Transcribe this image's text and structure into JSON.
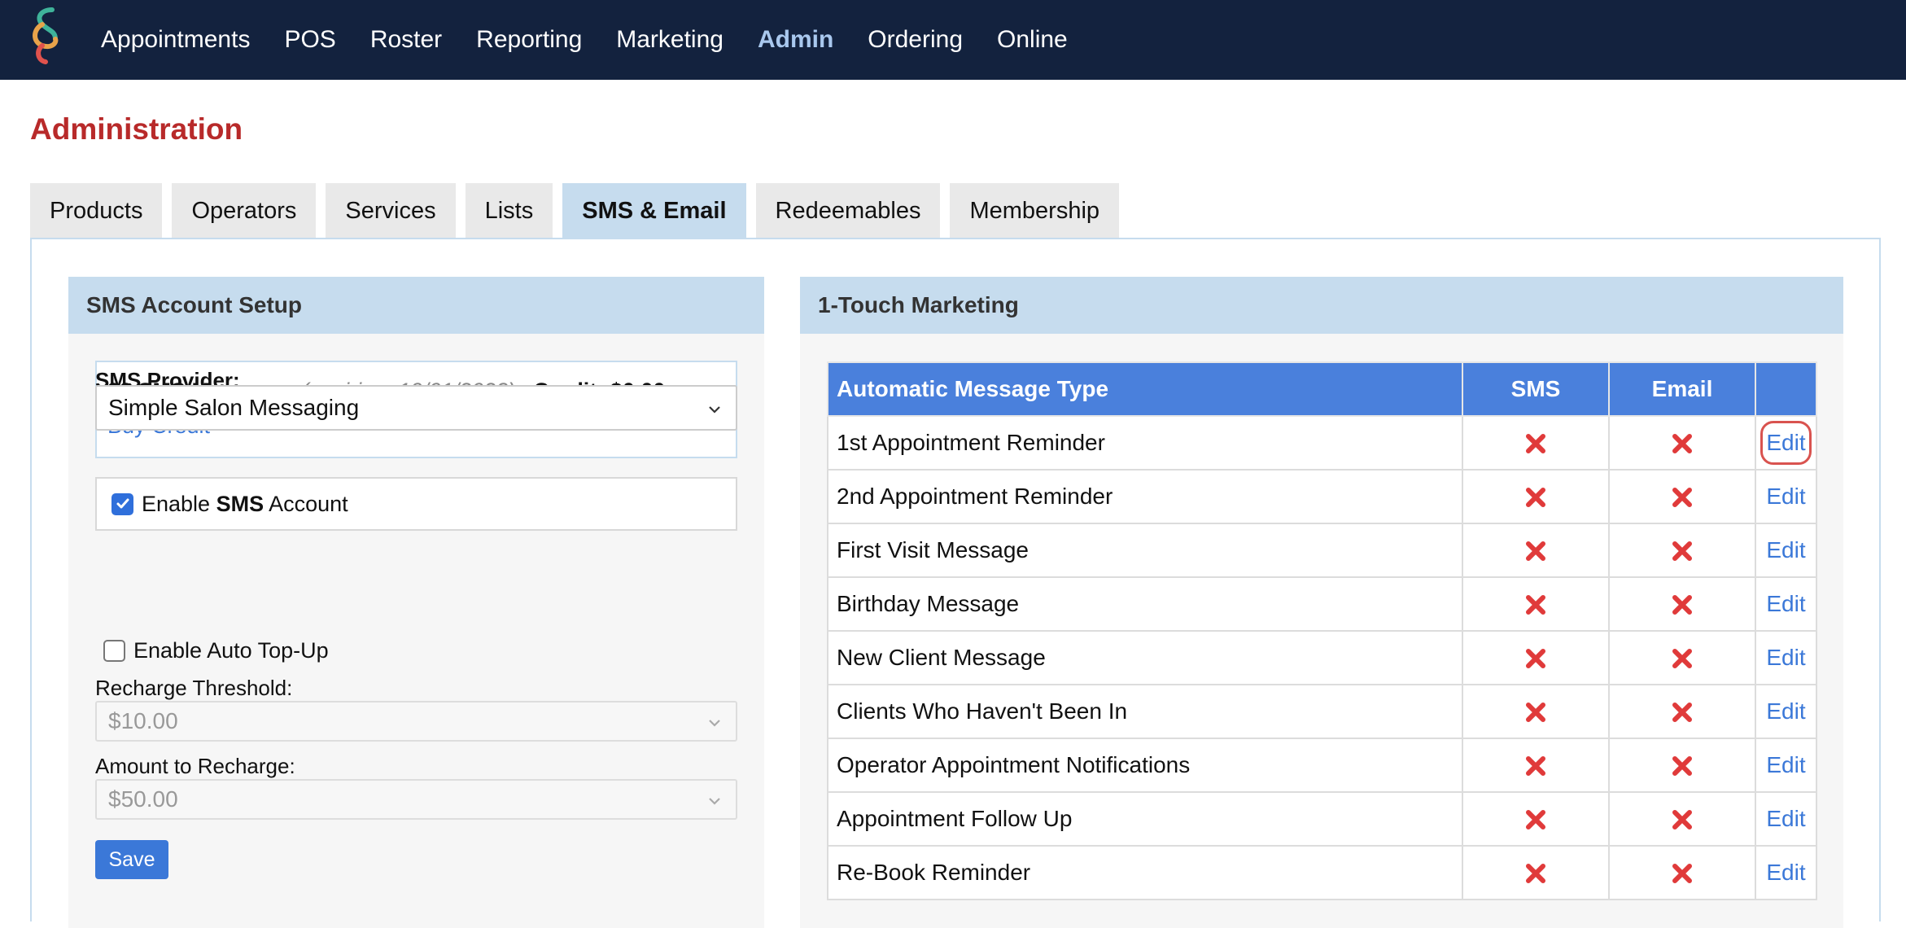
{
  "nav": {
    "items": [
      {
        "label": "Appointments",
        "active": false
      },
      {
        "label": "POS",
        "active": false
      },
      {
        "label": "Roster",
        "active": false
      },
      {
        "label": "Reporting",
        "active": false
      },
      {
        "label": "Marketing",
        "active": false
      },
      {
        "label": "Admin",
        "active": true
      },
      {
        "label": "Ordering",
        "active": false
      },
      {
        "label": "Online",
        "active": false
      }
    ]
  },
  "page": {
    "title": "Administration"
  },
  "tabs": [
    {
      "label": "Products",
      "active": false
    },
    {
      "label": "Operators",
      "active": false
    },
    {
      "label": "Services",
      "active": false
    },
    {
      "label": "Lists",
      "active": false
    },
    {
      "label": "SMS & Email",
      "active": true
    },
    {
      "label": "Redeemables",
      "active": false
    },
    {
      "label": "Membership",
      "active": false
    }
  ],
  "sms_setup": {
    "header": "SMS Account Setup",
    "messages": "32 SMS Messages",
    "expiry": "(expiring: 19/01/2023)",
    "credit": "Credit: $0.00",
    "buy_credit": "Buy Credit",
    "enable_prefix": "Enable ",
    "enable_bold": "SMS",
    "enable_suffix": " Account",
    "enable_checked": true,
    "provider_label": "SMS Provider:",
    "provider_value": "Simple Salon Messaging",
    "auto_topup_label": "Enable Auto Top-Up",
    "auto_topup_checked": false,
    "threshold_label": "Recharge Threshold:",
    "threshold_value": "$10.00",
    "recharge_label": "Amount to Recharge:",
    "recharge_value": "$50.00",
    "save_label": "Save"
  },
  "marketing": {
    "header": "1-Touch Marketing",
    "columns": [
      "Automatic Message Type",
      "SMS",
      "Email",
      ""
    ],
    "edit_label": "Edit",
    "rows": [
      {
        "type": "1st Appointment Reminder",
        "sms": false,
        "email": false,
        "highlighted": true
      },
      {
        "type": "2nd Appointment Reminder",
        "sms": false,
        "email": false,
        "highlighted": false
      },
      {
        "type": "First Visit Message",
        "sms": false,
        "email": false,
        "highlighted": false
      },
      {
        "type": "Birthday Message",
        "sms": false,
        "email": false,
        "highlighted": false
      },
      {
        "type": "New Client Message",
        "sms": false,
        "email": false,
        "highlighted": false
      },
      {
        "type": "Clients Who Haven't Been In",
        "sms": false,
        "email": false,
        "highlighted": false
      },
      {
        "type": "Operator Appointment Notifications",
        "sms": false,
        "email": false,
        "highlighted": false
      },
      {
        "type": "Appointment Follow Up",
        "sms": false,
        "email": false,
        "highlighted": false
      },
      {
        "type": "Re-Book Reminder",
        "sms": false,
        "email": false,
        "highlighted": false
      }
    ]
  },
  "colors": {
    "nav_bg": "#13223e",
    "accent": "#3b78d8",
    "title_red": "#b82a2a",
    "x_red": "#e03a3a"
  }
}
